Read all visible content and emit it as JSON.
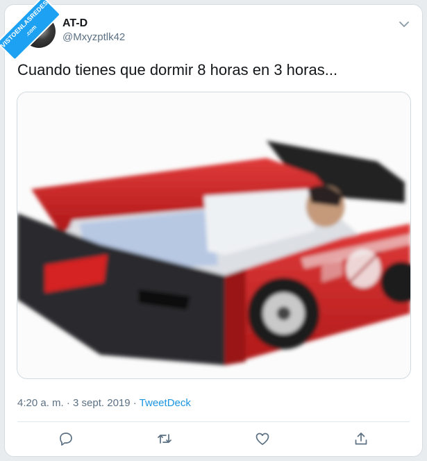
{
  "watermark": {
    "main": "VISTOENLASREDES",
    "sub": ".com"
  },
  "tweet": {
    "display_name": "AT-D",
    "handle": "@Mxyzptlk42",
    "text": "Cuando tienes que dormir 8 horas en 3 horas...",
    "timestamp": "4:20 a. m. · 3 sept. 2019 · ",
    "source": "TweetDeck"
  },
  "media": {
    "description_icon": "photo-race-car-bed"
  },
  "actions": [
    "reply-icon",
    "retweet-icon",
    "like-icon",
    "share-icon"
  ],
  "colors": {
    "accent": "#1b95e0",
    "secondary_text": "#5b7083",
    "watermark": "#1da1f2"
  }
}
